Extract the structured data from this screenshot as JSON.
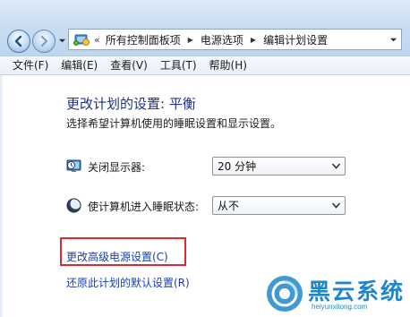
{
  "address_bar": {
    "overflow_marker": "«",
    "breadcrumbs": [
      "所有控制面板项",
      "电源选项",
      "编辑计划设置"
    ]
  },
  "menu": {
    "items": [
      "文件(F)",
      "编辑(E)",
      "查看(V)",
      "工具(T)",
      "帮助(H)"
    ]
  },
  "page": {
    "title": "更改计划的设置: 平衡",
    "description": "选择希望计算机使用的睡眠设置和显示设置。"
  },
  "settings": {
    "display_off": {
      "label": "关闭显示器:",
      "value": "20 分钟",
      "icon": "monitor-clock-icon"
    },
    "sleep": {
      "label": "使计算机进入睡眠状态:",
      "value": "从不",
      "icon": "moon-sleep-icon"
    }
  },
  "links": {
    "advanced": "更改高级电源设置(C)",
    "restore": "还原此计划的默认设置(R)"
  },
  "watermark": {
    "brand": "黑云系统",
    "url": "heiyunxitong.com"
  },
  "colors": {
    "title": "#1e3287",
    "link": "#1a3fad",
    "highlight": "#e0262f",
    "watermark": "#1f87c9"
  }
}
